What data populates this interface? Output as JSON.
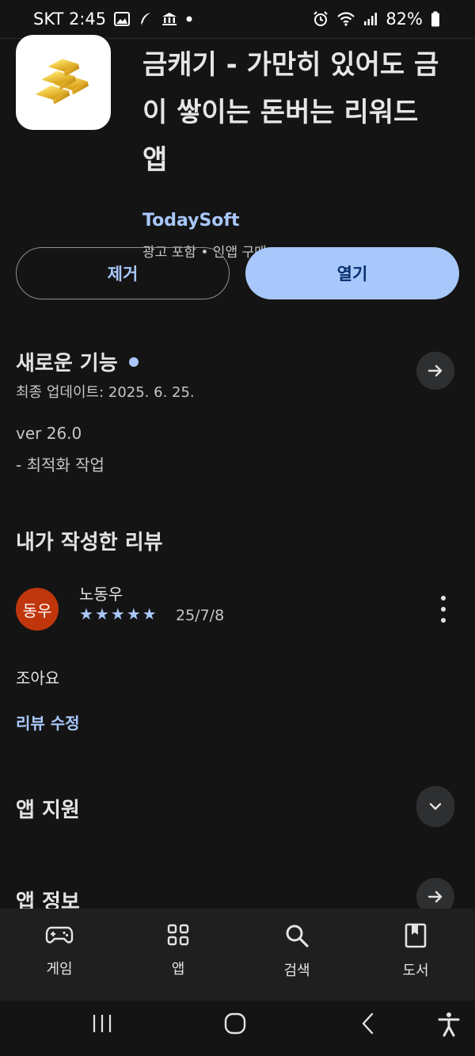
{
  "status_bar": {
    "carrier_time": "SKT 2:45",
    "battery": "82%",
    "icons": [
      "gallery-icon",
      "feather-icon",
      "bank-icon",
      "dot-icon",
      "alarm-icon",
      "wifi-icon",
      "signal-icon",
      "battery-icon"
    ]
  },
  "app": {
    "title": "금캐기 - 가만히 있어도 금이 쌓이는 돈버는 리워드 앱",
    "developer": "TodaySoft",
    "meta": "광고 포함 • 인앱 구매",
    "icon": "gold-bars-icon"
  },
  "actions": {
    "remove_label": "제거",
    "open_label": "열기"
  },
  "whats_new": {
    "title": "새로운 기능",
    "updated": "최종 업데이트: 2025. 6. 25.",
    "version": "ver 26.0",
    "notes": "- 최적화 작업"
  },
  "my_review": {
    "title": "내가 작성한 리뷰",
    "avatar_text": "동우",
    "reviewer_name": "노동우",
    "rating": 5,
    "date": "25/7/8",
    "text": "조아요",
    "edit_label": "리뷰 수정"
  },
  "app_support": {
    "title": "앱 지원"
  },
  "app_info": {
    "title": "앱 정보"
  },
  "bottom_nav": [
    {
      "label": "게임",
      "icon": "gamepad-icon"
    },
    {
      "label": "앱",
      "icon": "apps-grid-icon"
    },
    {
      "label": "검색",
      "icon": "search-icon"
    },
    {
      "label": "도서",
      "icon": "book-icon"
    }
  ],
  "system_nav": [
    "recents-icon",
    "home-icon",
    "back-icon",
    "accessibility-icon"
  ],
  "colors": {
    "background": "#141414",
    "accent": "#a8c7fa",
    "open_button_text": "#062e6f",
    "avatar": "#c0360c",
    "nav_background": "#1f1f1f"
  }
}
